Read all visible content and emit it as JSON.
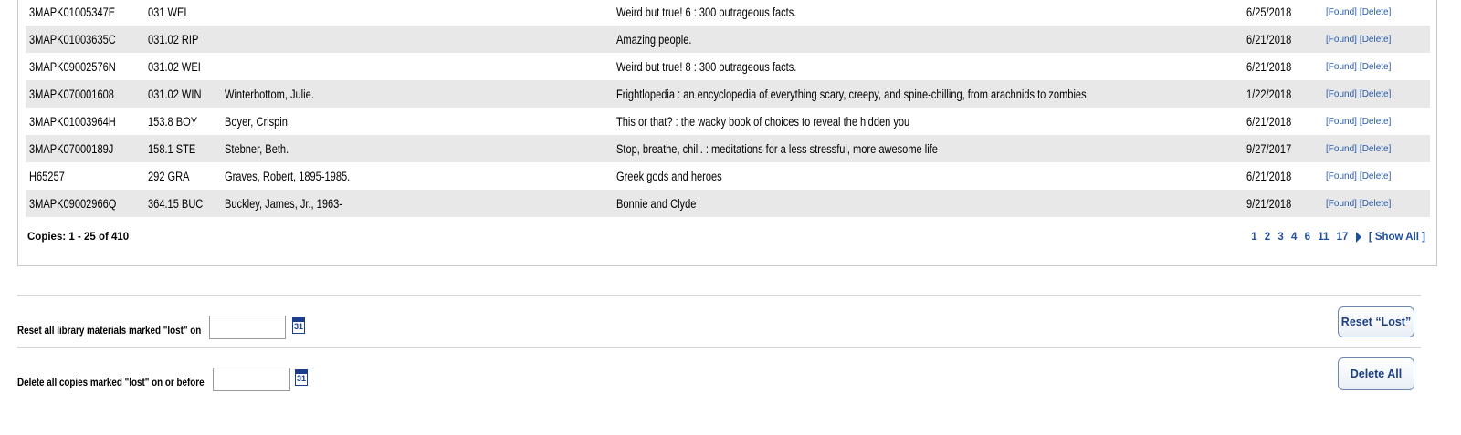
{
  "table": {
    "rows": [
      {
        "barcode": "3MAPK01005347E",
        "call": "031 WEI",
        "author": "",
        "title": "Weird but true! 6 : 300 outrageous facts.",
        "date": "6/25/2018"
      },
      {
        "barcode": "3MAPK01003635C",
        "call": "031.02 RIP",
        "author": "",
        "title": "Amazing people.",
        "date": "6/21/2018"
      },
      {
        "barcode": "3MAPK09002576N",
        "call": "031.02 WEI",
        "author": "",
        "title": "Weird but true! 8 : 300 outrageous facts.",
        "date": "6/21/2018"
      },
      {
        "barcode": "3MAPK070001608",
        "call": "031.02 WIN",
        "author": "Winterbottom, Julie.",
        "title": "Frightlopedia : an encyclopedia of everything scary, creepy, and spine-chilling, from arachnids to zombies",
        "date": "1/22/2018"
      },
      {
        "barcode": "3MAPK01003964H",
        "call": "153.8 BOY",
        "author": "Boyer, Crispin,",
        "title": "This or that? : the wacky book of choices to reveal the hidden you",
        "date": "6/21/2018"
      },
      {
        "barcode": "3MAPK07000189J",
        "call": "158.1 STE",
        "author": "Stebner, Beth.",
        "title": "Stop, breathe, chill. : meditations for a less stressful, more awesome life",
        "date": "9/27/2017"
      },
      {
        "barcode": "H65257",
        "call": "292 GRA",
        "author": "Graves, Robert, 1895-1985.",
        "title": "Greek gods and heroes",
        "date": "6/21/2018"
      },
      {
        "barcode": "3MAPK09002966Q",
        "call": "364.15 BUC",
        "author": "Buckley, James, Jr., 1963-",
        "title": "Bonnie and Clyde",
        "date": "9/21/2018"
      }
    ],
    "found_label": "[Found]",
    "delete_label": "[Delete]"
  },
  "footer": {
    "copies_count": "Copies: 1 - 25 of 410",
    "pages": [
      "1",
      "2",
      "3",
      "4",
      "6",
      "11",
      "17"
    ],
    "show_all": "[ Show All ]"
  },
  "reset": {
    "label": "Reset all library materials marked \"lost\" on",
    "button": "Reset “Lost”",
    "calendar_day": "31"
  },
  "delete": {
    "label": "Delete all copies marked \"lost\" on or before",
    "button": "Delete All",
    "calendar_day": "31"
  }
}
